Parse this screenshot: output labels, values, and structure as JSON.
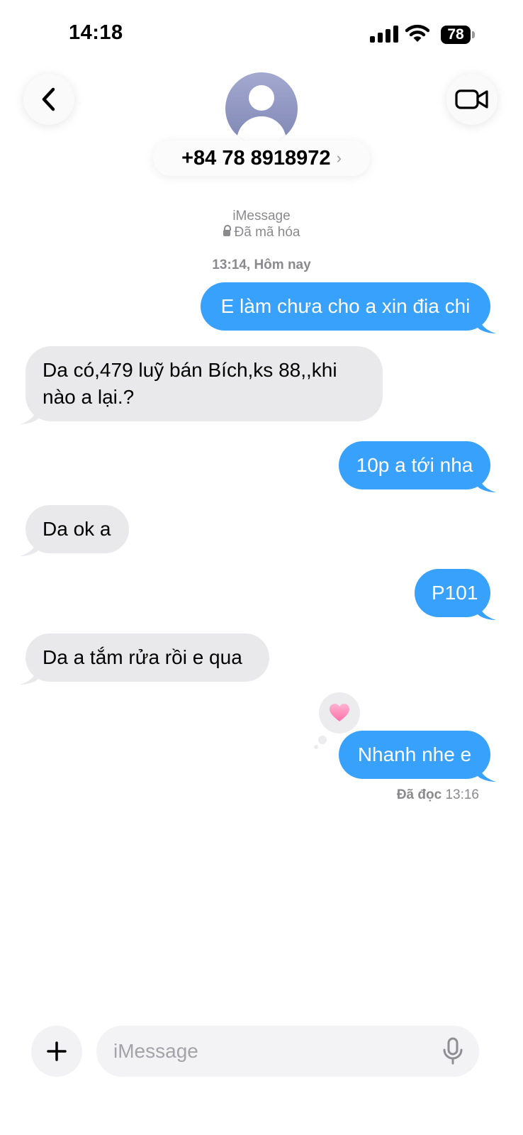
{
  "status_bar": {
    "time": "14:18",
    "battery": "78"
  },
  "header": {
    "contact": "+84 78 8918972"
  },
  "thread": {
    "service": "iMessage",
    "encryption": "Đã mã hóa",
    "timestamp": "13:14, Hôm nay"
  },
  "messages": [
    {
      "direction": "sent",
      "text": "E làm chưa cho a xin đia chi"
    },
    {
      "direction": "received",
      "text": "Da có,479 luỹ bán Bích,ks 88,,khi nào a lại.?"
    },
    {
      "direction": "sent",
      "text": "10p a tới nha"
    },
    {
      "direction": "received",
      "text": "Da ok a"
    },
    {
      "direction": "sent",
      "text": "P101"
    },
    {
      "direction": "received",
      "text": "Da a tắm rửa rồi e qua"
    },
    {
      "direction": "sent",
      "text": "Nhanh nhe e",
      "reaction": "heart"
    }
  ],
  "read_receipt": {
    "label": "Đã đọc",
    "time": "13:16"
  },
  "composer": {
    "placeholder": "iMessage"
  },
  "colors": {
    "sent_bubble": "#37a1fb",
    "received_bubble": "#e9e9eb",
    "meta_text": "#8a8a8e"
  }
}
